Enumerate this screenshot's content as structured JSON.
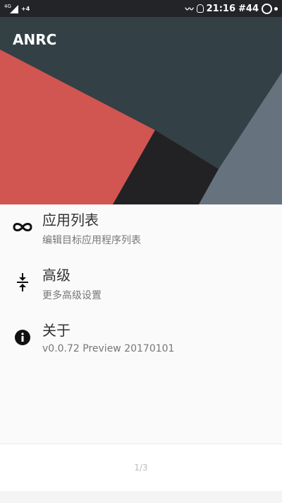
{
  "status_bar": {
    "signal_label": "4G",
    "net_label": "+4",
    "time": "21:16",
    "battery_level": "#44"
  },
  "header": {
    "title": "ANRC",
    "colors": {
      "bg": "#334046",
      "red": "#d15550",
      "dark": "#222224",
      "slate": "#66737e"
    }
  },
  "menu": [
    {
      "title": "应用列表",
      "subtitle": "编辑目标应用程序列表",
      "icon": "infinity-icon"
    },
    {
      "title": "高级",
      "subtitle": "更多高级设置",
      "icon": "compress-icon"
    },
    {
      "title": "关于",
      "subtitle": "v0.0.72 Preview 20170101",
      "icon": "info-icon"
    }
  ],
  "footer": {
    "page_indicator": "1/3"
  }
}
